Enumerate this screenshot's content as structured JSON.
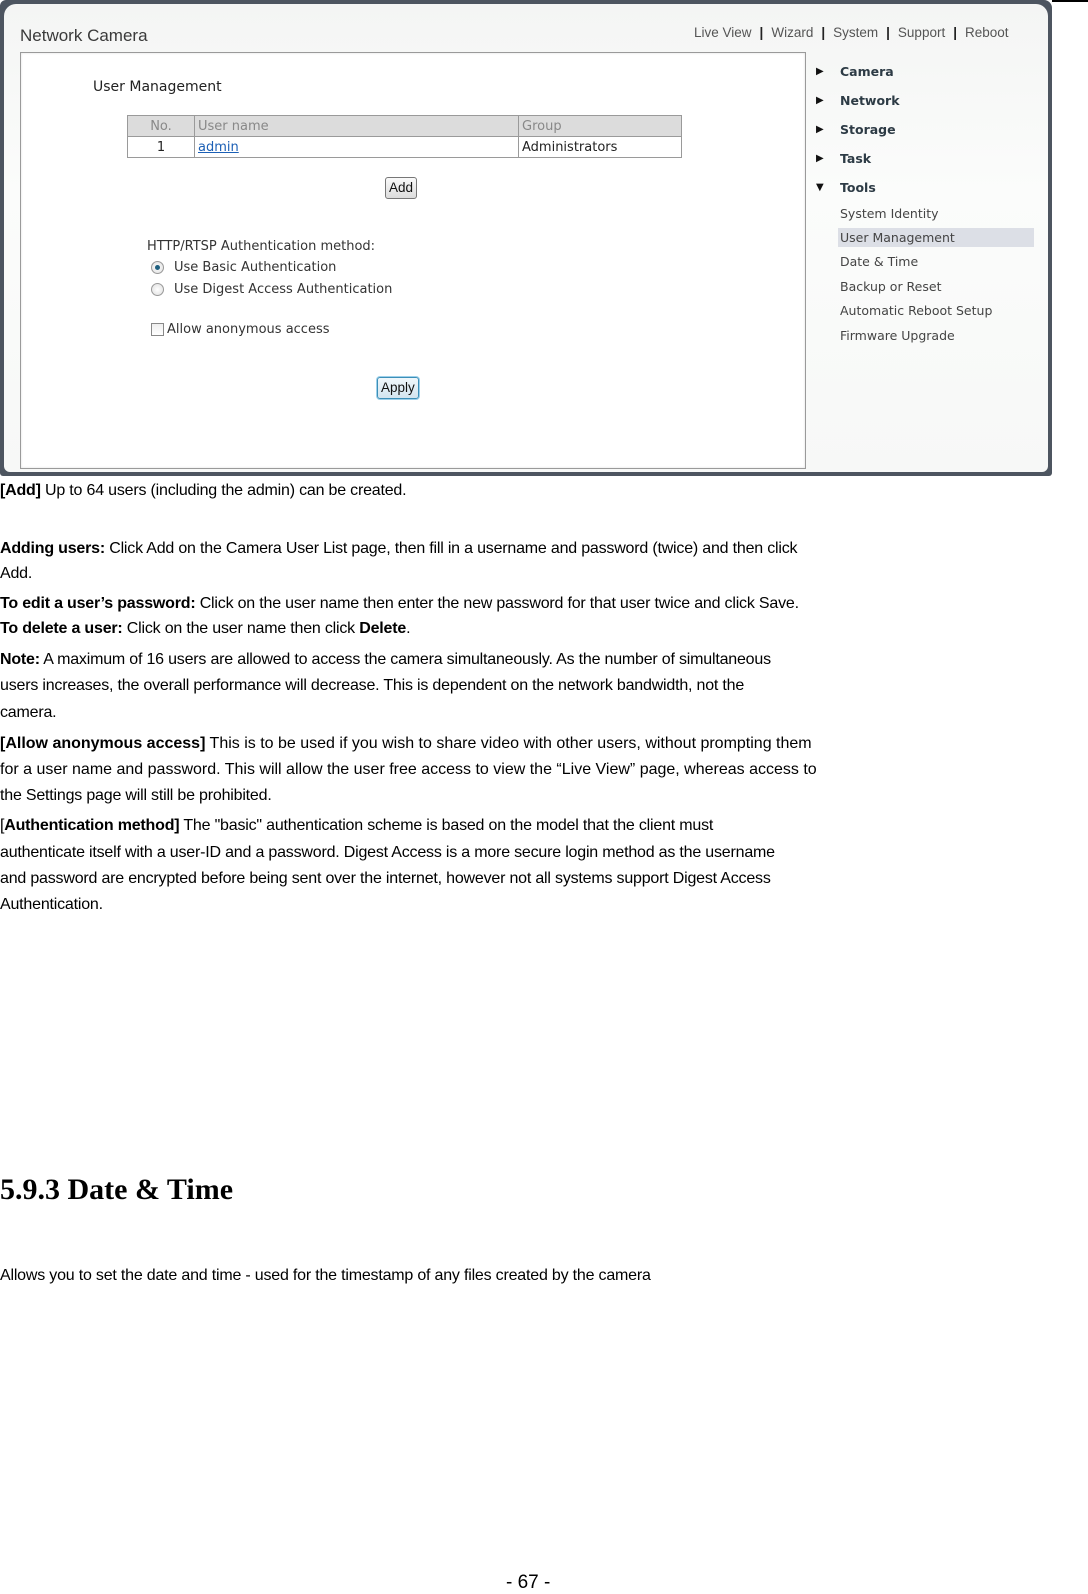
{
  "screenshot": {
    "app_title": "Network Camera",
    "top_nav": [
      "Live View",
      "Wizard",
      "System",
      "Support",
      "Reboot"
    ],
    "section_title": "User Management",
    "user_table": {
      "headers": [
        "No.",
        "User name",
        "Group"
      ],
      "rows": [
        {
          "no": "1",
          "username": "admin",
          "group": "Administrators"
        }
      ]
    },
    "add_button": "Add",
    "auth_method_label": "HTTP/RTSP Authentication method:",
    "auth_options": [
      {
        "label": "Use Basic Authentication",
        "selected": true
      },
      {
        "label": "Use Digest Access Authentication",
        "selected": false
      }
    ],
    "anonymous_checkbox": {
      "label": "Allow anonymous access",
      "checked": false
    },
    "apply_button": "Apply",
    "side_nav": {
      "sections": [
        {
          "label": "Camera",
          "expanded": false
        },
        {
          "label": "Network",
          "expanded": false
        },
        {
          "label": "Storage",
          "expanded": false
        },
        {
          "label": "Task",
          "expanded": false
        },
        {
          "label": "Tools",
          "expanded": true
        }
      ],
      "tools_items": [
        {
          "label": "System Identity",
          "active": false
        },
        {
          "label": "User Management",
          "active": true
        },
        {
          "label": "Date & Time",
          "active": false
        },
        {
          "label": "Backup or Reset",
          "active": false
        },
        {
          "label": "Automatic Reboot Setup",
          "active": false
        },
        {
          "label": "Firmware Upgrade",
          "active": false
        }
      ]
    }
  },
  "document": {
    "add_note": {
      "bold": "[Add]",
      "text": " Up to 64 users (including the admin) can be created."
    },
    "adding_users": {
      "bold": "Adding users:",
      "line1": " Click Add on the Camera User List page, then fill in a username and password (twice) and then click",
      "line2": "Add."
    },
    "edit_password": {
      "bold": "To edit a user’s password:",
      "text": " Click on the user name then enter the new password for that user twice and click Save."
    },
    "delete_user": {
      "bold": "To delete a user:",
      "text": " Click on the user name then click ",
      "bold2": "Delete",
      "end": "."
    },
    "note": {
      "bold": "Note:",
      "line1": " A maximum of 16 users are allowed to access the camera simultaneously. As the number of simultaneous",
      "line2": "users increases, the overall performance will decrease. This is dependent on the network bandwidth, not the",
      "line3": "camera."
    },
    "anonymous": {
      "bold": "[Allow anonymous access]",
      "line1": " This is to be used if you wish to share video with other users, without prompting them",
      "line2": "for a user name and password. This will allow the user free access to view the “Live View” page, whereas access to",
      "line3": "the Settings page will still be prohibited."
    },
    "auth_method": {
      "open": "[",
      "bold": "Authentication method]",
      "line1": " The \"basic\" authentication scheme is based on the model that the client must",
      "line2": "authenticate itself with a user-ID and a password. Digest Access is a more secure login method as the username",
      "line3": "and password are encrypted before being sent over the internet, however not all systems support Digest Access",
      "line4": "Authentication."
    },
    "section_heading": "5.9.3 Date & Time",
    "section_intro": "Allows you to set the date and time - used for the timestamp of any files created by the camera",
    "page_number": "- 67 -"
  }
}
